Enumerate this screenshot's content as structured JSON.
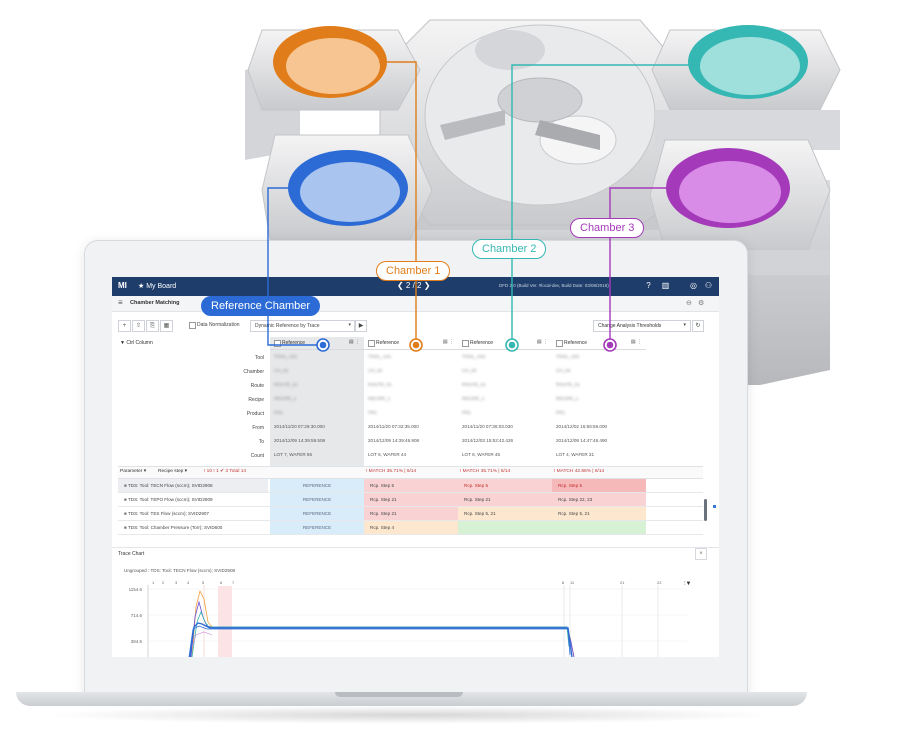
{
  "colors": {
    "reference": "#2c6bd6",
    "chamber1": "#e07d1a",
    "chamber2": "#35b7b3",
    "chamber3": "#a43ab9",
    "appbar": "#1f3d6b"
  },
  "callouts": {
    "reference": "Reference Chamber",
    "chamber1": "Chamber 1",
    "chamber2": "Chamber 2",
    "chamber3": "Chamber 3"
  },
  "app": {
    "logo": "MI",
    "board": "★ My Board",
    "pager": "❮ 2 / 2 ❯",
    "build_info": "DFD 2.0 (Build Ver. #local-dev, Build Date: 03/08/2018)"
  },
  "section": {
    "menu_icon": "≡",
    "title": "Chamber Matching"
  },
  "toolbar": {
    "data_normalization": "Data Normalization",
    "reference_mode": "Dynamic Reference by Trace",
    "threshold_button": "Change Analysis Thresholds"
  },
  "grid": {
    "column_toggle": "▼ Ctrl Column",
    "row_labels": [
      "Tool",
      "Chamber",
      "Route",
      "Recipe",
      "Product",
      "From",
      "To",
      "Count"
    ],
    "columns": [
      {
        "header": "Reference",
        "blurred": [
          "TOOL_A01",
          "CH_01",
          "ROUTE_01",
          "RECIPE_1",
          "PR1"
        ],
        "from": "2014/11/20 07:29:30.000",
        "to": "2014/12/09 14:39:59.508",
        "count": "LOT 7, WAFER 55"
      },
      {
        "header": "Reference",
        "blurred": [
          "TOOL_A01",
          "CH_02",
          "ROUTE_01",
          "RECIPE_1",
          "PR1"
        ],
        "from": "2014/11/20 07:32:35.000",
        "to": "2014/12/09 14:39:46.908",
        "count": "LOT 6, WAFER 44"
      },
      {
        "header": "Reference",
        "blurred": [
          "TOOL_A02",
          "CH_03",
          "ROUTE_01",
          "RECIPE_1",
          "PR1"
        ],
        "from": "2014/11/20 07:36:03.030",
        "to": "2014/12/03 15:52:42.426",
        "count": "LOT 6, WAFER 45"
      },
      {
        "header": "Reference",
        "blurred": [
          "TOOL_A02",
          "CH_04",
          "ROUTE_01",
          "RECIPE_1",
          "PR1"
        ],
        "from": "2014/12/02 15:56:56.000",
        "to": "2014/12/09 14:47:46.490",
        "count": "LOT 4, WAFER 31"
      }
    ]
  },
  "matchbar": {
    "parameter": "Parameter ▾",
    "recipe_step": "Recipe step ▾",
    "summary": "! 10  ! 1  ✔ 3  Total 14",
    "matches": [
      "",
      "! MATCH 35.71% | 5/14",
      "! MATCH 35.71% | 5/14",
      "! MATCH 42.86% | 6/14"
    ]
  },
  "parameters": [
    {
      "name": "TDS: Tool: TECN Flow (sccm); SVID2908",
      "cells": [
        "REFERENCE",
        "Rcp. Step 5",
        "Rcp. Step 5",
        "Rcp. Step 5"
      ]
    },
    {
      "name": "TDS: Tool: TEPO Flow (sccm); SVID2909",
      "cells": [
        "REFERENCE",
        "Rcp. Step 21",
        "Rcp. Step 21",
        "Rcp. Step 22, 23"
      ]
    },
    {
      "name": "TDS: Tool: TES Flow (sccm); SVID2907",
      "cells": [
        "REFERENCE",
        "Rcp. Step 21",
        "Rcp. Step 5, 21",
        "Rcp. Step 5, 21"
      ]
    },
    {
      "name": "TDS: Tool: Chamber Pressure (Torr); SVID600",
      "cells": [
        "REFERENCE",
        "Rcp. Step 4",
        "",
        ""
      ]
    }
  ],
  "trace": {
    "title": "Trace Chart",
    "close": "×",
    "subtitle": "Ungrouped : TDS: Tool: TECN Flow (sccm); SVID2908",
    "y_ticks": [
      "1154.6",
      "714.6",
      "384.5"
    ],
    "x_ticks_left": [
      "1",
      "2",
      "3",
      "4",
      "5",
      "6",
      "7"
    ],
    "x_ticks_right": [
      "8",
      "11",
      "21",
      "22"
    ]
  }
}
